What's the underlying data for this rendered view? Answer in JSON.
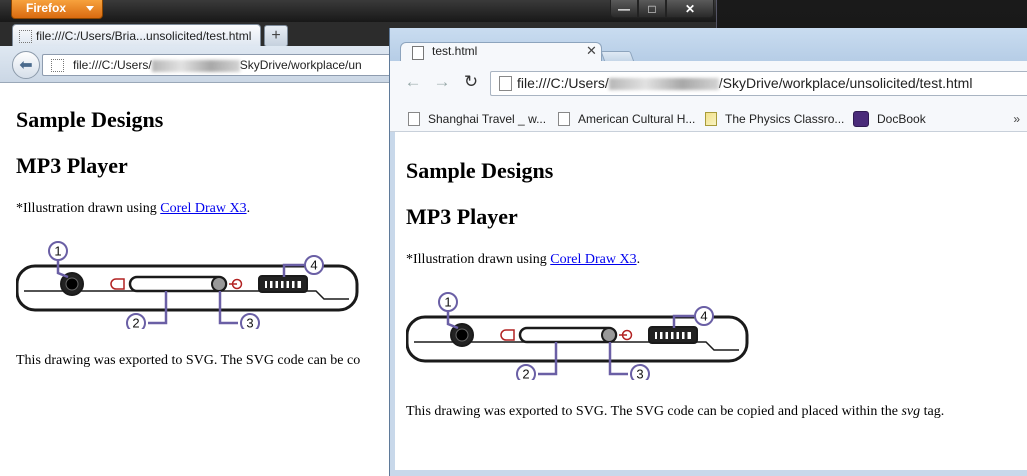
{
  "firefox": {
    "menu_label": "Firefox",
    "tab_title": "file:///C:/Users/Bria...unsolicited/test.html",
    "new_tab_label": "+",
    "url_prefix": "file:///C:/Users/",
    "url_suffix": "SkyDrive/workplace/un",
    "window_buttons": {
      "minimize": "—",
      "maximize": "□",
      "close": "✕"
    }
  },
  "chrome": {
    "tab_title": "test.html",
    "tab_close": "✕",
    "url_prefix": "file:///C:/Users/",
    "url_suffix": "/SkyDrive/workplace/unsolicited/test.html",
    "bookmarks": [
      {
        "label": "Shanghai Travel _ w...",
        "icon": "page-icon"
      },
      {
        "label": "American Cultural H...",
        "icon": "page-icon"
      },
      {
        "label": "The Physics Classro...",
        "icon": "physics-classroom-icon"
      },
      {
        "label": "DocBook",
        "icon": "docbook-icon"
      }
    ],
    "bookmarks_overflow": "»"
  },
  "page": {
    "heading1": "Sample Designs",
    "heading2": "MP3 Player",
    "illustration_prefix": "*Illustration drawn using ",
    "illustration_link": "Corel Draw X3",
    "illustration_suffix": ".",
    "callouts": [
      "1",
      "2",
      "3",
      "4"
    ],
    "export_text_prefix": "This drawing was exported to SVG. The SVG code can be copied and placed within the ",
    "export_text_em": "svg",
    "export_text_suffix": " tag.",
    "export_text_truncated": "This drawing was exported to SVG. The SVG code can be co"
  },
  "colors": {
    "callout": "#6a5fa5",
    "device_outline": "#1a1a1a",
    "red_icon": "#b22222",
    "link": "#0000ee",
    "firefox_orange": "#e8811f"
  }
}
